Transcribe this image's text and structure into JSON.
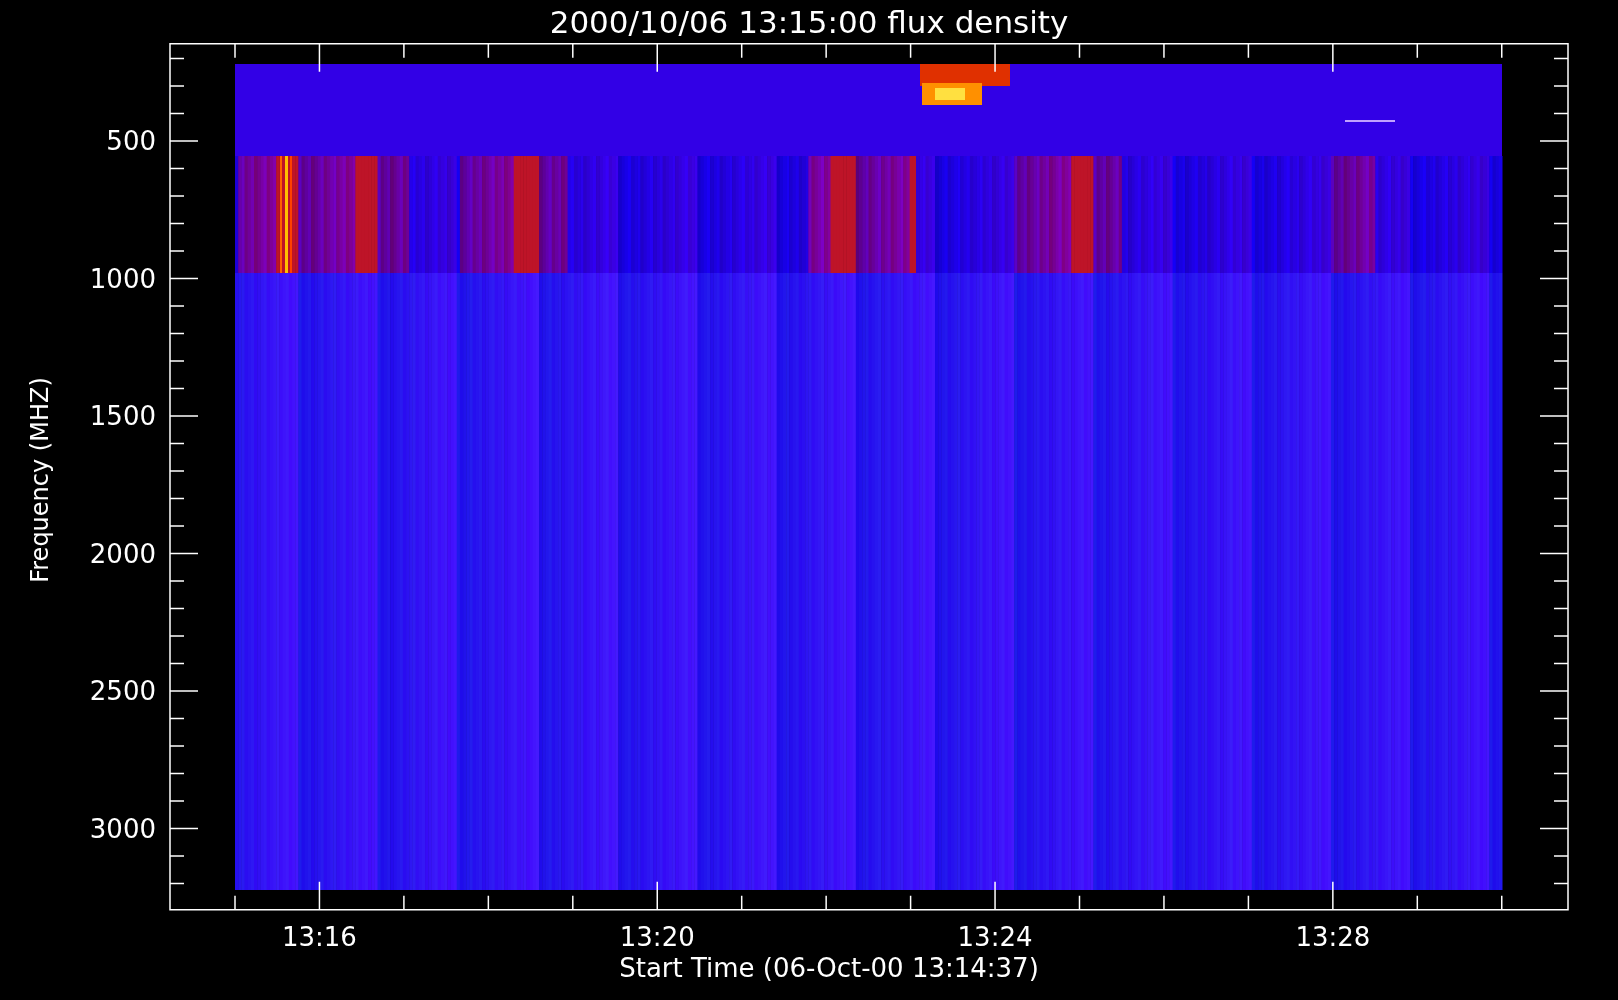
{
  "title": "2000/10/06 13:15:00 flux density",
  "y_axis": {
    "label": "Frequency (MHZ)",
    "ticks": [
      "500",
      "1000",
      "1500",
      "2000",
      "2500",
      "3000"
    ]
  },
  "x_axis": {
    "label": "Start Time (06-Oct-00 13:14:37)",
    "ticks": [
      "13:16",
      "13:20",
      "13:24",
      "13:28"
    ]
  }
}
